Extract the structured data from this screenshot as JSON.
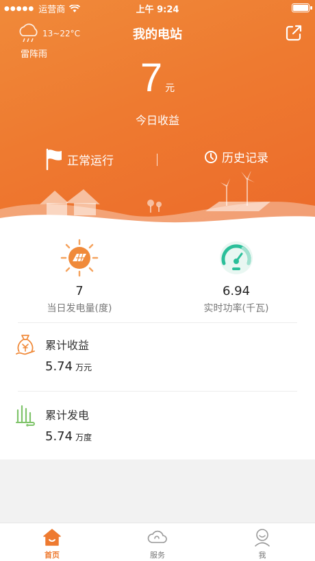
{
  "status_bar": {
    "carrier": "运营商",
    "time": "上午 9:24"
  },
  "weather": {
    "temperature": "13~22°C",
    "condition": "雷阵雨",
    "icon": "rain-cloud-icon"
  },
  "header": {
    "title": "我的电站",
    "share_icon": "share-icon"
  },
  "earnings": {
    "value": "7",
    "unit": "元",
    "label": "今日收益"
  },
  "status": {
    "running_label": "正常运行",
    "history_label": "历史记录"
  },
  "stats": {
    "daily_generation": {
      "value": "7",
      "label": "当日发电量(度)"
    },
    "realtime_power": {
      "value": "6.94",
      "label": "实时功率(千瓦)"
    }
  },
  "totals": {
    "income": {
      "label": "累计收益",
      "value": "5.74",
      "unit": "万元"
    },
    "generation": {
      "label": "累计发电",
      "value": "5.74",
      "unit": "万度"
    }
  },
  "tabs": [
    {
      "label": "首页",
      "icon": "home-icon",
      "active": true
    },
    {
      "label": "服务",
      "icon": "cloud-icon",
      "active": false
    },
    {
      "label": "我",
      "icon": "user-icon",
      "active": false
    }
  ],
  "colors": {
    "accent": "#ee7a30",
    "gradient_start": "#f08a3a",
    "gradient_end": "#ec6a2a",
    "gauge": "#2bbf9a",
    "plant": "#7fc46a"
  }
}
